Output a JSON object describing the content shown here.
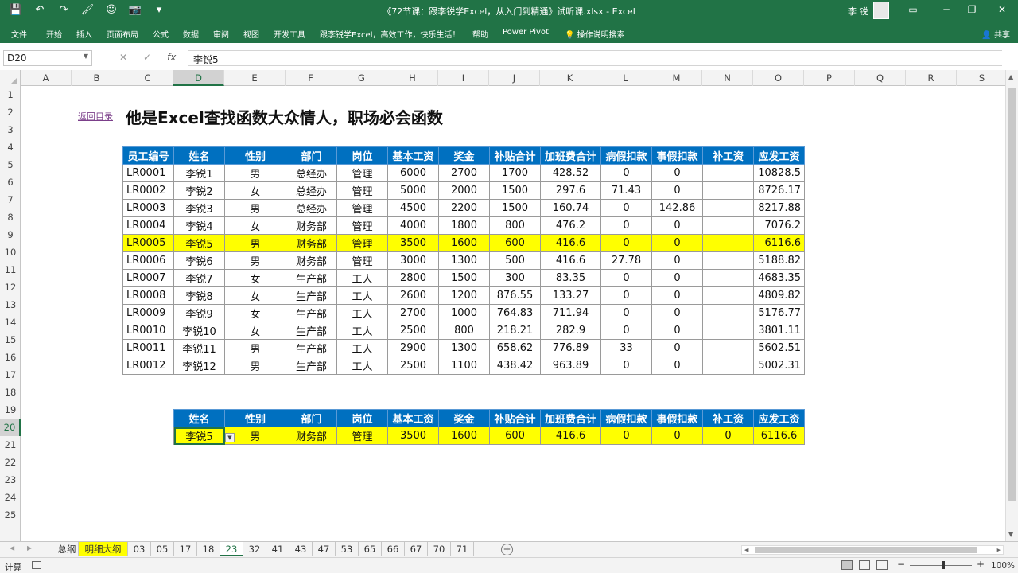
{
  "window": {
    "title": "《72节课：跟李锐学Excel，从入门到精通》试听课.xlsx  -  Excel",
    "user": "李 锐",
    "quick_access": [
      "💾",
      "↶",
      "↷",
      "🖌",
      "☺",
      "📷",
      "▾"
    ],
    "controls": [
      "▭",
      "─",
      "❐",
      "✕"
    ]
  },
  "ribbon": {
    "tabs": [
      "文件",
      "开始",
      "插入",
      "页面布局",
      "公式",
      "数据",
      "审阅",
      "视图",
      "开发工具",
      "跟李锐学Excel，高效工作，快乐生活！",
      "帮助",
      "Power Pivot",
      "💡 操作说明搜索"
    ],
    "share": "共享"
  },
  "formula_bar": {
    "name_box": "D20",
    "cancel": "✕",
    "enter": "✓",
    "fx": "fx",
    "content": "李锐5"
  },
  "columns": [
    "A",
    "B",
    "C",
    "D",
    "E",
    "F",
    "G",
    "H",
    "I",
    "J",
    "K",
    "L",
    "M",
    "N",
    "O",
    "P",
    "Q",
    "R",
    "S"
  ],
  "selected_column": "D",
  "rows": [
    "1",
    "2",
    "3",
    "4",
    "5",
    "6",
    "7",
    "8",
    "9",
    "10",
    "11",
    "12",
    "13",
    "14",
    "15",
    "16",
    "17",
    "18",
    "19",
    "20",
    "21",
    "22",
    "23",
    "24",
    "25"
  ],
  "selected_row": "20",
  "sheet": {
    "back_link": "返回目录",
    "title": "他是Excel查找函数大众情人，职场必会函数",
    "headers": [
      "员工编号",
      "姓名",
      "性别",
      "部门",
      "岗位",
      "基本工资",
      "奖金",
      "补贴合计",
      "加班费合计",
      "病假扣款",
      "事假扣款",
      "补工资",
      "应发工资"
    ],
    "rows": [
      [
        "LR0001",
        "李锐1",
        "男",
        "总经办",
        "管理",
        "6000",
        "2700",
        "1700",
        "428.52",
        "0",
        "0",
        "",
        "10828.5"
      ],
      [
        "LR0002",
        "李锐2",
        "女",
        "总经办",
        "管理",
        "5000",
        "2000",
        "1500",
        "297.6",
        "71.43",
        "0",
        "",
        "8726.17"
      ],
      [
        "LR0003",
        "李锐3",
        "男",
        "总经办",
        "管理",
        "4500",
        "2200",
        "1500",
        "160.74",
        "0",
        "142.86",
        "",
        "8217.88"
      ],
      [
        "LR0004",
        "李锐4",
        "女",
        "财务部",
        "管理",
        "4000",
        "1800",
        "800",
        "476.2",
        "0",
        "0",
        "",
        "7076.2"
      ],
      [
        "LR0005",
        "李锐5",
        "男",
        "财务部",
        "管理",
        "3500",
        "1600",
        "600",
        "416.6",
        "0",
        "0",
        "",
        "6116.6"
      ],
      [
        "LR0006",
        "李锐6",
        "男",
        "财务部",
        "管理",
        "3000",
        "1300",
        "500",
        "416.6",
        "27.78",
        "0",
        "",
        "5188.82"
      ],
      [
        "LR0007",
        "李锐7",
        "女",
        "生产部",
        "工人",
        "2800",
        "1500",
        "300",
        "83.35",
        "0",
        "0",
        "",
        "4683.35"
      ],
      [
        "LR0008",
        "李锐8",
        "女",
        "生产部",
        "工人",
        "2600",
        "1200",
        "876.55",
        "133.27",
        "0",
        "0",
        "",
        "4809.82"
      ],
      [
        "LR0009",
        "李锐9",
        "女",
        "生产部",
        "工人",
        "2700",
        "1000",
        "764.83",
        "711.94",
        "0",
        "0",
        "",
        "5176.77"
      ],
      [
        "LR0010",
        "李锐10",
        "女",
        "生产部",
        "工人",
        "2500",
        "800",
        "218.21",
        "282.9",
        "0",
        "0",
        "",
        "3801.11"
      ],
      [
        "LR0011",
        "李锐11",
        "男",
        "生产部",
        "工人",
        "2900",
        "1300",
        "658.62",
        "776.89",
        "33",
        "0",
        "",
        "5602.51"
      ],
      [
        "LR0012",
        "李锐12",
        "男",
        "生产部",
        "工人",
        "2500",
        "1100",
        "438.42",
        "963.89",
        "0",
        "0",
        "",
        "5002.31"
      ]
    ],
    "highlight_row_index": 4,
    "lookup_headers": [
      "姓名",
      "性别",
      "部门",
      "岗位",
      "基本工资",
      "奖金",
      "补贴合计",
      "加班费合计",
      "病假扣款",
      "事假扣款",
      "补工资",
      "应发工资"
    ],
    "lookup_row": [
      "李锐5",
      "男",
      "财务部",
      "管理",
      "3500",
      "1600",
      "600",
      "416.6",
      "0",
      "0",
      "0",
      "6116.6"
    ]
  },
  "sheet_tabs": [
    "总纲",
    "明细大纲",
    "03",
    "05",
    "17",
    "18",
    "23",
    "32",
    "41",
    "43",
    "47",
    "53",
    "65",
    "66",
    "67",
    "70",
    "71"
  ],
  "active_tab": "23",
  "yellow_tab": "明细大纲",
  "status": {
    "mode": "计算",
    "zoom": "100%"
  },
  "colors": {
    "excel_green": "#217346",
    "header_blue": "#0070c0",
    "highlight_yellow": "#ffff00",
    "link_purple": "#7b3f8a"
  }
}
